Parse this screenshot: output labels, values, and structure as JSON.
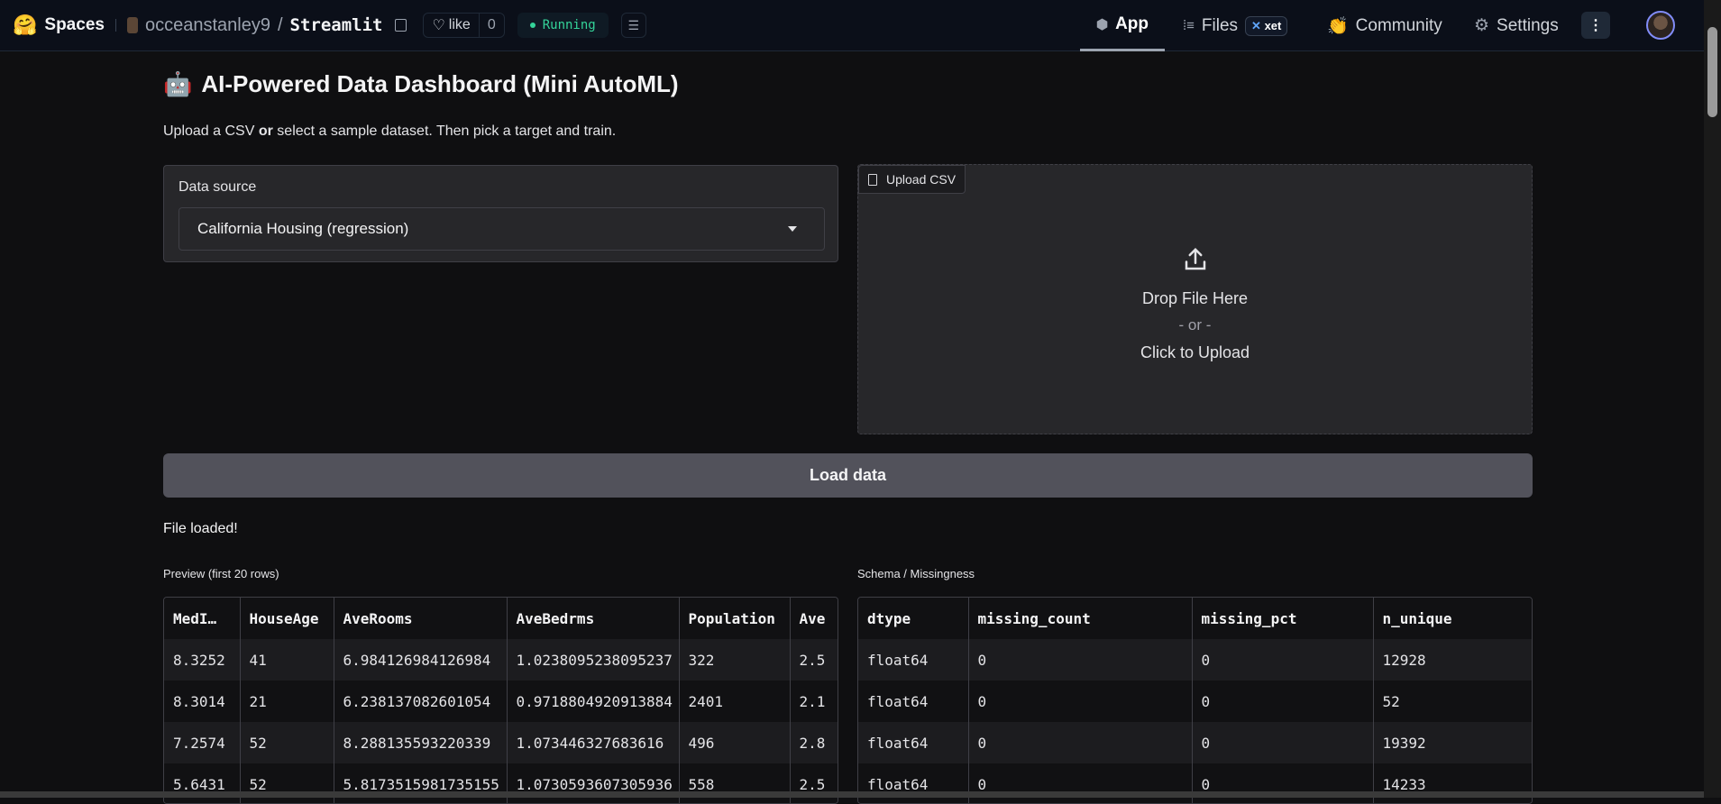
{
  "header": {
    "brand": "Spaces",
    "owner": "occeanstanley9",
    "slash": "/",
    "repo": "Streamlit",
    "like_label": "like",
    "like_count": "0",
    "status": "Running",
    "nav": [
      {
        "label": "App"
      },
      {
        "label": "Files",
        "badge": "xet"
      },
      {
        "label": "Community"
      },
      {
        "label": "Settings"
      }
    ],
    "more": "⋮"
  },
  "main": {
    "title": "AI-Powered Data Dashboard (Mini AutoML)",
    "subtitle_pre": "Upload a CSV ",
    "subtitle_bold": "or",
    "subtitle_post": " select a sample dataset. Then pick a target and train.",
    "data_source_label": "Data source",
    "data_source_value": "California Housing (regression)",
    "upload_label": "Upload CSV",
    "drop_text": "Drop File Here",
    "or_text": "- or -",
    "click_text": "Click to Upload",
    "load_button": "Load data",
    "status_msg": "File loaded!",
    "preview_label": "Preview (first 20 rows)",
    "schema_label": "Schema / Missingness"
  },
  "preview": {
    "columns": [
      "MedI…",
      "HouseAge",
      "AveRooms",
      "AveBedrms",
      "Population",
      "Ave"
    ],
    "rows": [
      [
        "8.3252",
        "41",
        "6.984126984126984",
        "1.0238095238095237",
        "322",
        "2.5"
      ],
      [
        "8.3014",
        "21",
        "6.238137082601054",
        "0.9718804920913884",
        "2401",
        "2.1"
      ],
      [
        "7.2574",
        "52",
        "8.288135593220339",
        "1.073446327683616",
        "496",
        "2.8"
      ],
      [
        "5.6431",
        "52",
        "5.8173515981735155",
        "1.0730593607305936",
        "558",
        "2.5"
      ]
    ]
  },
  "schema": {
    "columns": [
      "dtype",
      "missing_count",
      "missing_pct",
      "n_unique"
    ],
    "rows": [
      [
        "float64",
        "0",
        "0",
        "12928"
      ],
      [
        "float64",
        "0",
        "0",
        "52"
      ],
      [
        "float64",
        "0",
        "0",
        "19392"
      ],
      [
        "float64",
        "0",
        "0",
        "14233"
      ]
    ]
  }
}
